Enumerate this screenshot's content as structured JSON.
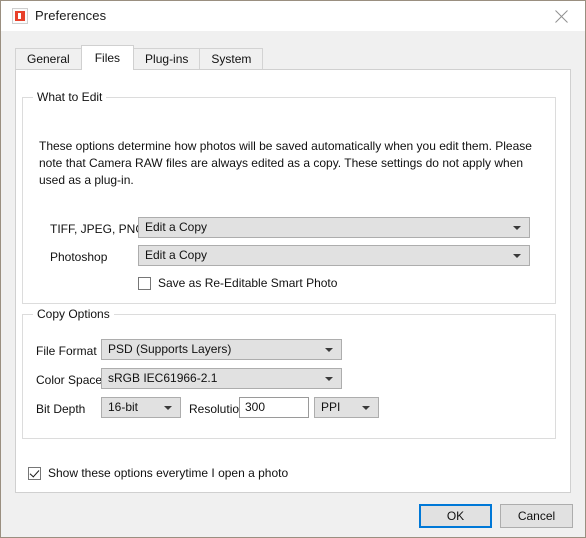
{
  "window": {
    "title": "Preferences",
    "icon": "app-icon",
    "close_icon": "close-icon"
  },
  "tabs": [
    {
      "label": "General",
      "active": false
    },
    {
      "label": "Files",
      "active": true
    },
    {
      "label": "Plug-ins",
      "active": false
    },
    {
      "label": "System",
      "active": false
    }
  ],
  "what_to_edit": {
    "group_title": "What to Edit",
    "description": "These options determine how photos will be saved automatically when you edit them.  Please note that Camera RAW files are always edited as a copy.  These settings do not apply when used as a plug-in.",
    "tiff_label": "TIFF, JPEG, PNG",
    "tiff_value": "Edit a Copy",
    "photoshop_label": "Photoshop",
    "photoshop_value": "Edit a Copy",
    "smart_photo_label": "Save as Re-Editable Smart Photo",
    "smart_photo_checked": false
  },
  "copy_options": {
    "group_title": "Copy Options",
    "file_format_label": "File Format",
    "file_format_value": "PSD (Supports Layers)",
    "color_space_label": "Color Space",
    "color_space_value": "sRGB IEC61966-2.1",
    "bit_depth_label": "Bit Depth",
    "bit_depth_value": "16-bit",
    "resolution_label": "Resolution",
    "resolution_value": "300",
    "resolution_unit_value": "PPI"
  },
  "footer": {
    "show_options_label": "Show these options everytime I open a photo",
    "show_options_checked": true,
    "ok_label": "OK",
    "cancel_label": "Cancel"
  },
  "colors": {
    "accent": "#0078d7",
    "icon_red": "#e8402a",
    "panel_bg": "#ffffff",
    "window_bg": "#f0f0f0",
    "control_bg": "#e1e1e1"
  }
}
